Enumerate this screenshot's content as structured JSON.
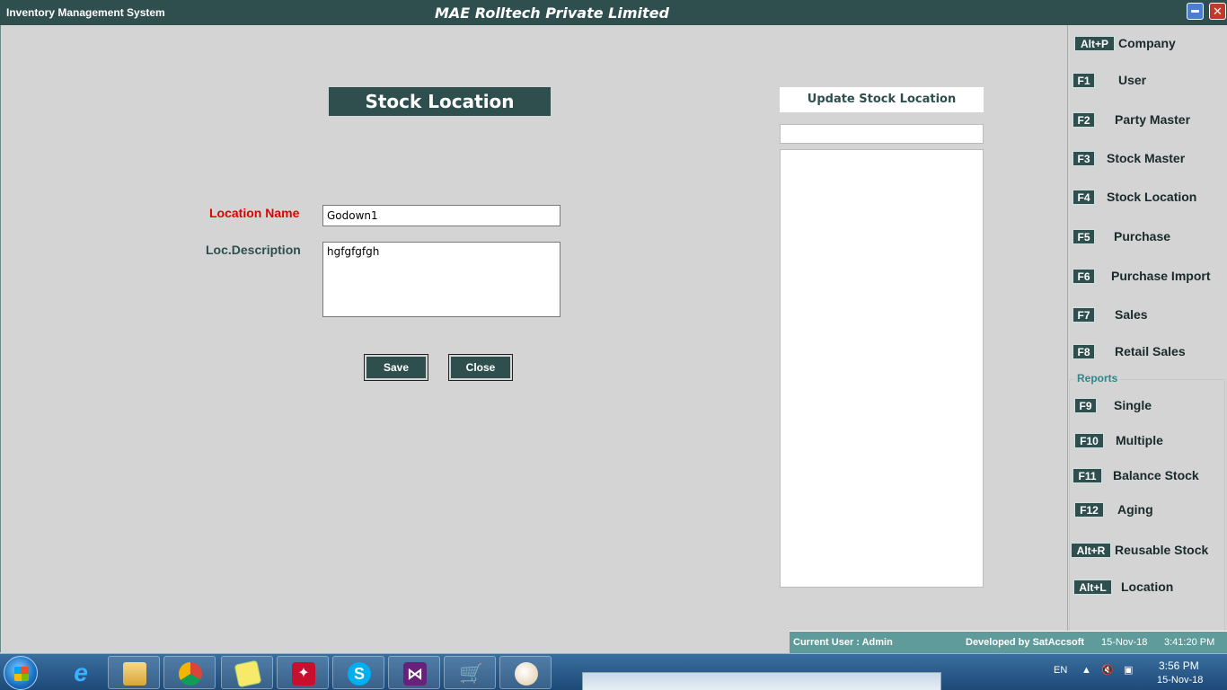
{
  "titlebar": {
    "app_name": "Inventory Management System",
    "company": "MAE Rolltech Private Limited",
    "close_glyph": "✕"
  },
  "form": {
    "title": "Stock Location",
    "location_name_label": "Location Name",
    "location_name_value": "Godown1",
    "description_label": "Loc.Description",
    "description_value": "hgfgfgfgh",
    "save_label": "Save",
    "close_label": "Close"
  },
  "update_panel": {
    "title": "Update Stock Location",
    "search_value": "",
    "items": []
  },
  "sidebar": {
    "items": [
      {
        "key": "Alt+P",
        "label": "Company"
      },
      {
        "key": "F1",
        "label": "User"
      },
      {
        "key": "F2",
        "label": "Party Master"
      },
      {
        "key": "F3",
        "label": "Stock Master"
      },
      {
        "key": "F4",
        "label": "Stock Location"
      },
      {
        "key": "F5",
        "label": "Purchase"
      },
      {
        "key": "F6",
        "label": "Purchase Import"
      },
      {
        "key": "F7",
        "label": "Sales"
      },
      {
        "key": "F8",
        "label": "Retail Sales"
      }
    ],
    "reports_title": "Reports",
    "reports": [
      {
        "key": "F9",
        "label": "Single"
      },
      {
        "key": "F10",
        "label": "Multiple"
      },
      {
        "key": "F11",
        "label": "Balance Stock"
      },
      {
        "key": "F12",
        "label": "Aging"
      },
      {
        "key": "Alt+R",
        "label": "Reusable Stock"
      },
      {
        "key": "Alt+L",
        "label": "Location"
      }
    ]
  },
  "status": {
    "current_user": "Current User : Admin",
    "developer": "Developed by SatAccsoft",
    "date": "15-Nov-18",
    "time": "3:41:20 PM"
  },
  "taskbar": {
    "apps": [
      "start-icon",
      "ie-icon",
      "explorer-icon",
      "chrome-icon",
      "sticky-notes-icon",
      "acrobat-icon",
      "skype-icon",
      "visual-studio-icon",
      "cart-app-icon",
      "paint-icon"
    ],
    "lang": "EN",
    "clock_time": "3:56 PM",
    "clock_date": "15-Nov-18"
  },
  "colors": {
    "primary": "#2f4f4f",
    "required_label": "#e00000",
    "status_bar": "#5f9b9b",
    "reports_title": "#2a8a8a"
  }
}
